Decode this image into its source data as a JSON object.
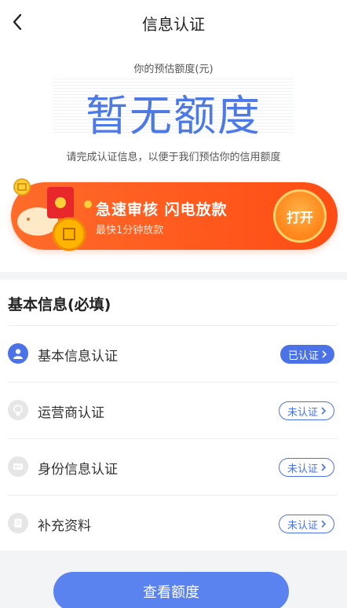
{
  "header": {
    "title": "信息认证"
  },
  "estimate": {
    "label": "你的预估额度(元)",
    "amount": "暂无额度",
    "hint": "请完成认证信息，以便于我们预估你的信用额度"
  },
  "banner": {
    "title": "急速审核  闪电放款",
    "subtitle": "最快1分钟放款",
    "button": "打开"
  },
  "basic_info": {
    "title": "基本信息(必填)",
    "items": [
      {
        "label": "基本信息认证",
        "status": "已认证",
        "icon": "user-icon"
      },
      {
        "label": "运营商认证",
        "status": "未认证",
        "icon": "operator-icon"
      },
      {
        "label": "身份信息认证",
        "status": "未认证",
        "icon": "id-card-icon"
      },
      {
        "label": "补充资料",
        "status": "未认证",
        "icon": "document-icon"
      }
    ]
  },
  "submit": {
    "label": "查看额度"
  },
  "colors": {
    "accent": "#4b72e6",
    "banner": "#ff5a1e"
  }
}
